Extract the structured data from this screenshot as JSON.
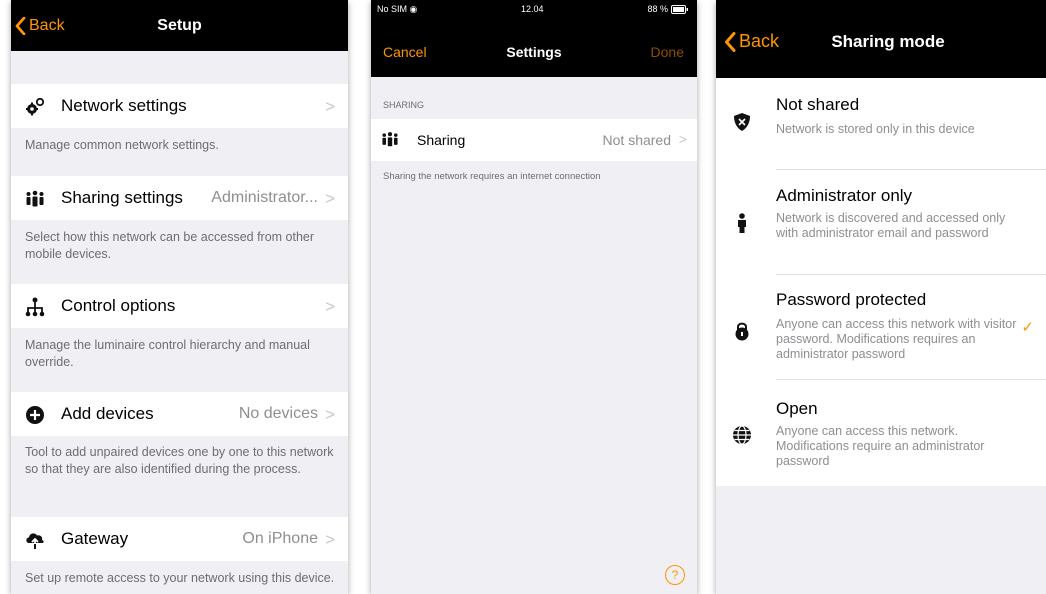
{
  "setup": {
    "nav": {
      "back": "Back",
      "title": "Setup"
    },
    "items": [
      {
        "label": "Network settings",
        "value": "",
        "desc": "Manage common network settings."
      },
      {
        "label": "Sharing settings",
        "value": "Administrator...",
        "desc": "Select how this network can be accessed from other mobile devices."
      },
      {
        "label": "Control options",
        "value": "",
        "desc": "Manage the luminaire control hierarchy and manual override."
      },
      {
        "label": "Add devices",
        "value": "No devices",
        "desc": "Tool to add unpaired devices one by one to this network so that they are also identified during the process."
      },
      {
        "label": "Gateway",
        "value": "On iPhone",
        "desc": "Set up remote access to your network using this device."
      }
    ]
  },
  "settings": {
    "status": {
      "carrier": "No SIM",
      "time": "12.04",
      "battery": "88 %"
    },
    "nav": {
      "cancel": "Cancel",
      "title": "Settings",
      "done": "Done"
    },
    "section": "SHARING",
    "row": {
      "label": "Sharing",
      "value": "Not shared"
    },
    "footer": "Sharing the network requires an internet connection",
    "help": "?"
  },
  "sharing": {
    "nav": {
      "back": "Back",
      "title": "Sharing mode"
    },
    "options": [
      {
        "title": "Not shared",
        "subtitle": "Network is stored only in this device",
        "icon": "shield-x-icon"
      },
      {
        "title": "Administrator only",
        "subtitle": "Network is discovered and accessed only with administrator email and password",
        "icon": "person-icon"
      },
      {
        "title": "Password protected",
        "subtitle": "Anyone can access this network with visitor password. Modifications requires an administrator password",
        "icon": "lock-icon",
        "selected": true
      },
      {
        "title": "Open",
        "subtitle": "Anyone can access this network. Modifications require an administrator password",
        "icon": "globe-icon"
      }
    ]
  },
  "colors": {
    "accent": "#ff9500",
    "nav": "#000000",
    "background": "#efeff4"
  }
}
